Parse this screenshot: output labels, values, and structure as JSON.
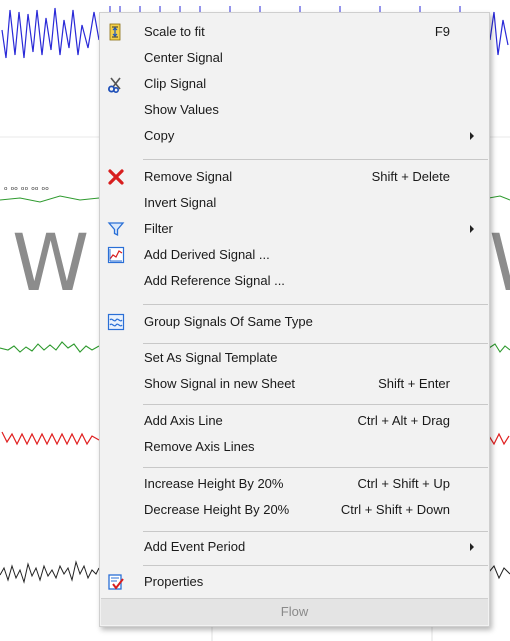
{
  "background": {
    "left_letter": "W",
    "right_letter": "W"
  },
  "menu": {
    "items": [
      {
        "label": "Scale to fit",
        "shortcut": "F9",
        "icon": "scale-to-fit-icon"
      },
      {
        "label": "Center Signal",
        "shortcut": ""
      },
      {
        "label": "Clip Signal",
        "shortcut": "",
        "icon": "scissors-icon"
      },
      {
        "label": "Show Values",
        "shortcut": ""
      },
      {
        "label": "Copy",
        "shortcut": "",
        "submenu": true
      },
      {
        "label": "Remove Signal",
        "shortcut": "Shift + Delete",
        "icon": "remove-x-icon"
      },
      {
        "label": "Invert Signal",
        "shortcut": ""
      },
      {
        "label": "Filter",
        "shortcut": "",
        "submenu": true,
        "icon": "filter-icon"
      },
      {
        "label": "Add Derived Signal ...",
        "shortcut": "",
        "icon": "derived-signal-icon"
      },
      {
        "label": "Add Reference Signal ...",
        "shortcut": ""
      },
      {
        "label": "Group Signals Of Same Type",
        "shortcut": "",
        "icon": "group-signals-icon"
      },
      {
        "label": "Set As Signal Template",
        "shortcut": ""
      },
      {
        "label": "Show Signal in new Sheet",
        "shortcut": "Shift + Enter"
      },
      {
        "label": "Add Axis Line",
        "shortcut": "Ctrl + Alt + Drag"
      },
      {
        "label": "Remove Axis Lines",
        "shortcut": ""
      },
      {
        "label": "Increase Height By 20%",
        "shortcut": "Ctrl + Shift + Up"
      },
      {
        "label": "Decrease Height By 20%",
        "shortcut": "Ctrl + Shift + Down"
      },
      {
        "label": "Add Event Period",
        "shortcut": "",
        "submenu": true
      },
      {
        "label": "Properties",
        "shortcut": "",
        "icon": "properties-icon"
      }
    ],
    "footer": "Flow"
  },
  "colors": {
    "signal_blue": "#2a2ad8",
    "signal_green": "#2e9a2e",
    "signal_red": "#e02020",
    "signal_black": "#222222",
    "remove_red": "#d81e1e",
    "filter_blue": "#2a6fd6"
  }
}
